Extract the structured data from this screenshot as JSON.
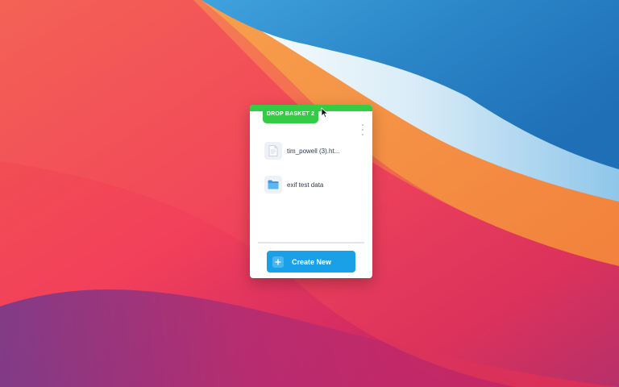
{
  "colors": {
    "accent_green": "#33cc44",
    "button_blue": "#1aa0e6",
    "text_dark": "#2b3a55"
  },
  "basket": {
    "title": "DROP BASKET 2",
    "more_icon": "vertical-ellipsis-icon",
    "items": [
      {
        "label": "tim_powell (3).ht...",
        "icon": "document-icon"
      },
      {
        "label": "exif test data",
        "icon": "folder-icon"
      }
    ],
    "create_button": {
      "label": "Create New",
      "icon": "plus-icon"
    }
  }
}
